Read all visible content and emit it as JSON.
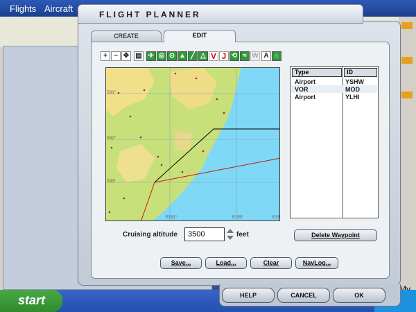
{
  "background": {
    "menu_items": [
      "Flights",
      "Aircraft"
    ],
    "start_label": "start",
    "right_label": "My"
  },
  "dialog": {
    "title": "FLIGHT PLANNER",
    "tabs": [
      {
        "label": "CREATE",
        "active": false
      },
      {
        "label": "EDIT",
        "active": true
      }
    ]
  },
  "toolbar": {
    "icons": [
      "zoom-in-icon",
      "zoom-out-icon",
      "center-icon",
      "print-icon",
      "airport-filter-icon",
      "vor-filter-icon",
      "ndb-filter-icon",
      "intersection-filter-icon",
      "airway-low-icon",
      "airway-high-icon",
      "victor-airway-icon",
      "jet-route-icon",
      "route-icon",
      "wind-icon",
      "weather-icon",
      "label-icon",
      "airport-icon"
    ],
    "labels": [
      "V",
      "J",
      "W"
    ]
  },
  "map": {
    "lat_labels": [
      "S31°",
      "S32°",
      "S33°"
    ],
    "lon_labels": [
      "E152°",
      "E153°",
      "E15"
    ]
  },
  "waypoints": {
    "columns": [
      "Type",
      "ID"
    ],
    "rows": [
      {
        "type": "Airport",
        "id": "YSHW"
      },
      {
        "type": "VOR",
        "id": "MOD"
      },
      {
        "type": "Airport",
        "id": "YLHI"
      }
    ]
  },
  "altitude": {
    "label": "Cruising altitude",
    "value": "3500",
    "units": "feet"
  },
  "buttons": {
    "delete_waypoint": "Delete Waypoint",
    "save": "Save...",
    "load": "Load...",
    "clear": "Clear",
    "navlog": "NavLog...",
    "help": "HELP",
    "cancel": "CANCEL",
    "ok": "OK"
  },
  "colors": {
    "route_black": "#000000",
    "route_red": "#c81414",
    "sea": "#7fd8f5",
    "land": "#c8e07a",
    "highland": "#f2df8a"
  }
}
